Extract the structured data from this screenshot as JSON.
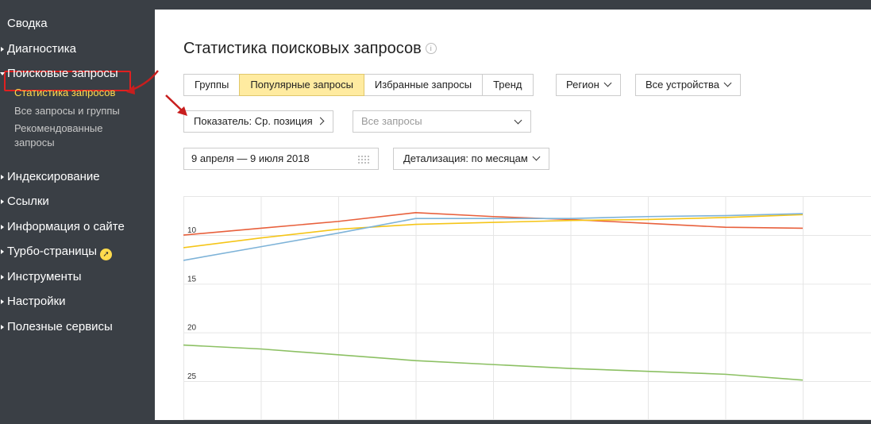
{
  "sidebar": {
    "items": [
      {
        "label": "Сводка"
      },
      {
        "label": "Диагностика"
      },
      {
        "label": "Поисковые запросы"
      },
      {
        "label": "Индексирование"
      },
      {
        "label": "Ссылки"
      },
      {
        "label": "Информация о сайте"
      },
      {
        "label": "Турбо-страницы"
      },
      {
        "label": "Инструменты"
      },
      {
        "label": "Настройки"
      },
      {
        "label": "Полезные сервисы"
      }
    ],
    "subitems": [
      {
        "label": "Статистика запросов",
        "active": true
      },
      {
        "label": "Все запросы и группы"
      },
      {
        "label": "Рекомендованные"
      },
      {
        "label": "запросы"
      }
    ]
  },
  "main": {
    "title": "Статистика поисковых запросов",
    "tabs": [
      {
        "label": "Группы"
      },
      {
        "label": "Популярные запросы",
        "active": true
      },
      {
        "label": "Избранные запросы"
      },
      {
        "label": "Тренд"
      }
    ],
    "region_label": "Регион",
    "devices_label": "Все устройства",
    "indicator_label": "Показатель: Ср. позиция",
    "query_select": {
      "value": "Все запросы"
    },
    "date_range": "9 апреля — 9 июля 2018",
    "detail_label": "Детализация: по месяцам"
  },
  "colors": {
    "accent": "#ffeba0",
    "active_sub": "#ffdb4d",
    "highlight": "#e02020"
  },
  "chart_data": {
    "type": "line",
    "y_reversed": true,
    "yticks": [
      "10",
      "15",
      "20",
      "25"
    ],
    "ylim": [
      6,
      29
    ],
    "x": [
      0,
      1,
      2,
      3,
      4,
      5,
      6,
      7,
      8
    ],
    "series": [
      {
        "color": "#e8603c",
        "values": [
          10,
          9.3,
          8.6,
          7.7,
          8.1,
          8.4,
          8.8,
          9.2,
          9.3
        ]
      },
      {
        "color": "#f5c518",
        "values": [
          11.3,
          10.3,
          9.4,
          8.9,
          8.7,
          8.5,
          8.4,
          8.2,
          7.9
        ]
      },
      {
        "color": "#7eb3d8",
        "values": [
          12.6,
          11.2,
          9.8,
          8.3,
          8.3,
          8.3,
          8.1,
          8.0,
          7.8
        ]
      },
      {
        "color": "#8cc063",
        "values": [
          21.3,
          21.7,
          22.3,
          22.9,
          23.3,
          23.7,
          24.0,
          24.3,
          24.9
        ]
      }
    ]
  }
}
